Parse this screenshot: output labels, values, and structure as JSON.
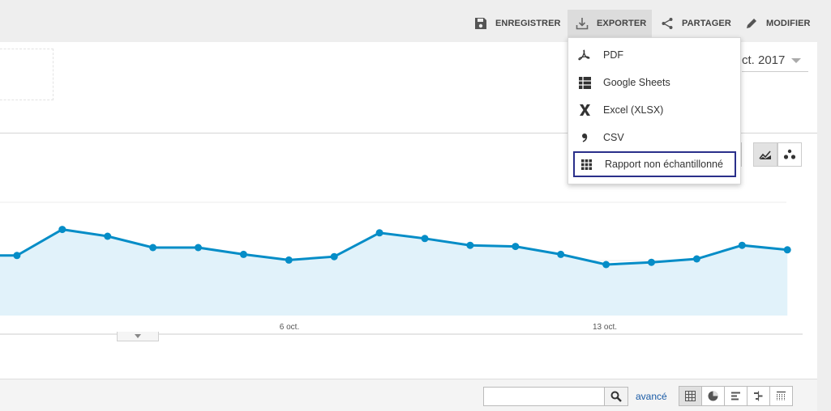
{
  "toolbar": {
    "save_label": "ENREGISTRER",
    "export_label": "EXPORTER",
    "share_label": "PARTAGER",
    "edit_label": "MODIFIER"
  },
  "header": {
    "date_range_visible": "ct. 2017"
  },
  "export_menu": {
    "items": [
      {
        "label": "PDF",
        "icon": "pdf-icon"
      },
      {
        "label": "Google Sheets",
        "icon": "google-sheets-icon"
      },
      {
        "label": "Excel (XLSX)",
        "icon": "excel-icon"
      },
      {
        "label": "CSV",
        "icon": "csv-icon"
      },
      {
        "label": "Rapport non échantillonné",
        "icon": "unsampled-report-icon"
      }
    ],
    "highlighted_index": 4
  },
  "chart_data": {
    "type": "area",
    "x_labels": [
      "6 oct.",
      "13 oct."
    ],
    "values": [
      0.53,
      0.53,
      0.76,
      0.7,
      0.6,
      0.6,
      0.54,
      0.49,
      0.52,
      0.73,
      0.68,
      0.62,
      0.61,
      0.54,
      0.45,
      0.47,
      0.5,
      0.62,
      0.58
    ],
    "line_color": "#058dc7",
    "fill_color": "#e1f2fa",
    "grid": true
  },
  "table_controls": {
    "search_value": "",
    "advanced_label": "avancé"
  },
  "colors": {
    "accent": "#058dc7",
    "highlight_border": "#2a2f8a",
    "link": "#1a5ba6"
  }
}
